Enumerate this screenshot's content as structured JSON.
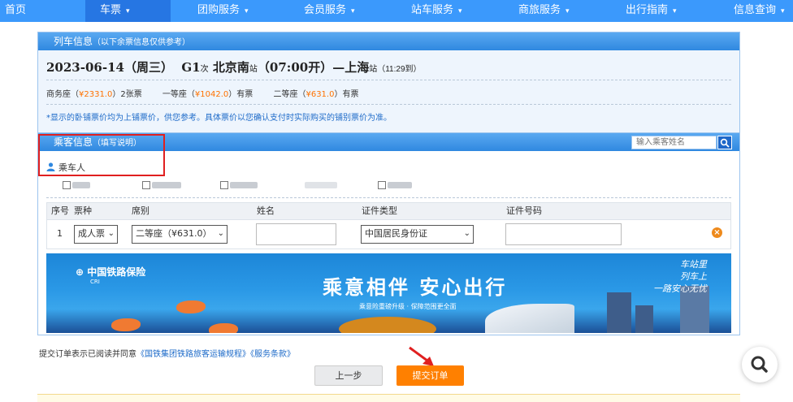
{
  "nav": {
    "items": [
      {
        "label": "首页",
        "caret": false
      },
      {
        "label": "车票",
        "caret": true,
        "active": true
      },
      {
        "label": "团购服务",
        "caret": true
      },
      {
        "label": "会员服务",
        "caret": true
      },
      {
        "label": "站车服务",
        "caret": true
      },
      {
        "label": "商旅服务",
        "caret": true
      },
      {
        "label": "出行指南",
        "caret": true
      },
      {
        "label": "信息查询",
        "caret": true
      }
    ],
    "caret_glyph": "⌄"
  },
  "train_info": {
    "header": "列车信息",
    "header_sub": "（以下余票信息仅供参考）",
    "date": "2023-06-14（周三）",
    "train_no": "G1",
    "train_suffix": "次",
    "from": "北京南",
    "from_suffix": "站",
    "depart": "（07:00开）",
    "dash": "—",
    "to": "上海",
    "to_suffix": "站",
    "arrive": "（11:29到）",
    "seats": [
      {
        "name": "商务座（",
        "price": "¥2331.0",
        "close": "）",
        "left": "2张票"
      },
      {
        "name": "一等座（",
        "price": "¥1042.0",
        "close": "）",
        "left": "有票"
      },
      {
        "name": "二等座（",
        "price": "¥631.0",
        "close": "）",
        "left": "有票"
      }
    ],
    "note": "*显示的卧铺票价均为上铺票价，供您参考。具体票价以您确认支付时实际购买的铺别票价为准。"
  },
  "passenger": {
    "header": "乘客信息",
    "header_sub": "（填写说明）",
    "search_placeholder": "输入乘客姓名",
    "person_label": "乘车人",
    "table": {
      "headers": [
        "序号",
        "票种",
        "席别",
        "姓名",
        "证件类型",
        "证件号码"
      ],
      "row": {
        "index": "1",
        "ticket_type": "成人票",
        "seat_class": "二等座（¥631.0）",
        "name": "",
        "id_type": "中国居民身份证",
        "id_number": ""
      }
    }
  },
  "banner": {
    "logo": "中国铁路保险",
    "logo_sub": "CRI",
    "slogan": "乘意相伴 安心出行",
    "sub": "乘意险重磅升级 · 保障范围更全面",
    "calligraphy_1": "车站里",
    "calligraphy_2": "列车上",
    "calligraphy_3": "一路安心无忧"
  },
  "footer": {
    "agree_text": "提交订单表示已阅读并同意",
    "link1": "《国铁集团铁路旅客运输规程》",
    "link2": "《服务条款》",
    "prev_button": "上一步",
    "submit_button": "提交订单"
  },
  "colors": {
    "nav_bg": "#3b99fc",
    "nav_active": "#2676e3",
    "accent_orange": "#ff8000",
    "price": "#ff7200",
    "link": "#1e6bc9"
  }
}
